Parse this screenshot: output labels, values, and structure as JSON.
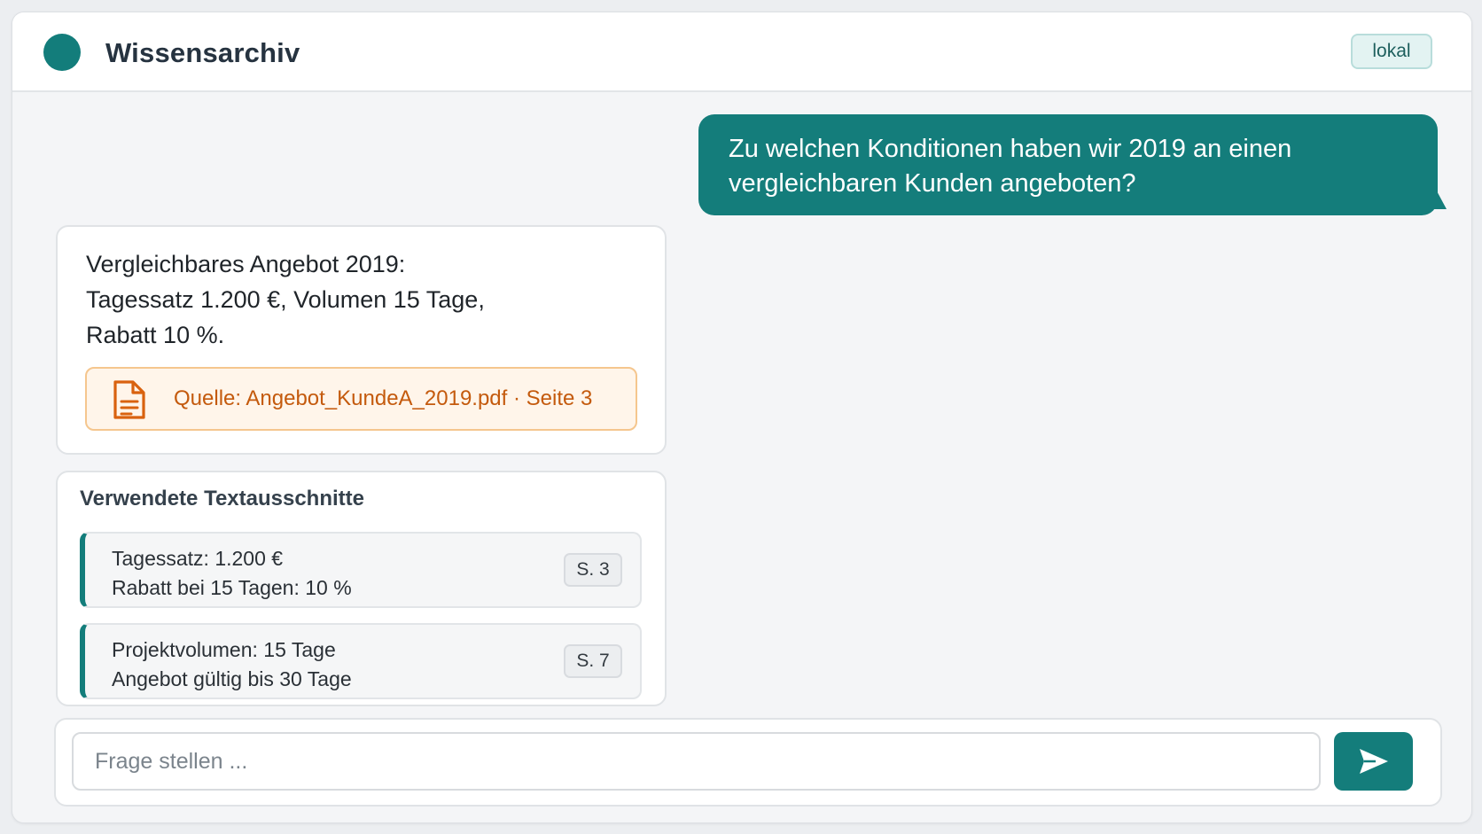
{
  "header": {
    "title": "Wissensarchiv",
    "badge": "lokal",
    "logo_icon": "circle-logo-icon"
  },
  "conversation": {
    "user_message": {
      "lines": [
        "Zu welchen Konditionen haben wir 2019 an einen",
        "vergleichbaren Kunden angeboten?"
      ]
    },
    "assistant_answer": {
      "lines": [
        "Vergleichbares Angebot 2019:",
        "Tagessatz 1.200 €, Volumen 15 Tage,",
        "Rabatt 10 %."
      ],
      "source": {
        "icon": "document-icon",
        "label": "Quelle: Angebot_KundeA_2019.pdf · Seite 3"
      }
    }
  },
  "snippets": {
    "title": "Verwendete Textausschnitte",
    "items": [
      {
        "lines": [
          "Tagessatz: 1.200 €",
          "Rabatt bei 15 Tagen: 10 %"
        ],
        "page": "S. 3"
      },
      {
        "lines": [
          "Projektvolumen: 15 Tage",
          "Angebot gültig bis 30 Tage"
        ],
        "page": "S. 7"
      }
    ]
  },
  "composer": {
    "placeholder": "Frage stellen ...",
    "value": "",
    "send_icon": "send-icon"
  },
  "colors": {
    "accent": "#147d7b",
    "source_bg": "#fff5ea",
    "source_border": "#f5c68e",
    "source_text": "#c45a0d",
    "badge_bg": "#e3f3f2"
  }
}
